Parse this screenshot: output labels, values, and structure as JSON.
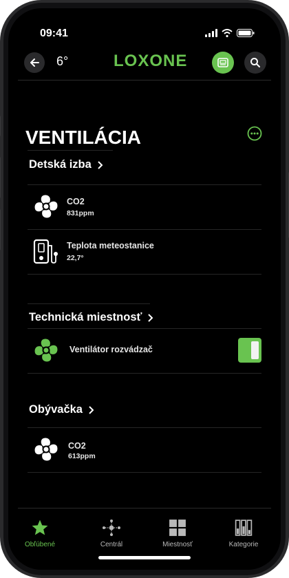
{
  "status": {
    "time": "09:41"
  },
  "header": {
    "temperature": "6°",
    "logo": "LOXONE"
  },
  "page": {
    "title": "VENTILÁCIA"
  },
  "sections": [
    {
      "title": "Detská izba",
      "rows": [
        {
          "label": "CO2",
          "value": "831ppm",
          "icon": "fan-icon"
        },
        {
          "label": "Teplota meteostanice",
          "value": "22,7°",
          "icon": "thermometer-icon"
        }
      ]
    },
    {
      "title": "Technická miestnosť",
      "rows": [
        {
          "label": "Ventilátor rozvádzač",
          "icon": "fan-icon",
          "switch_on": true
        }
      ]
    },
    {
      "title": "Obývačka",
      "rows": [
        {
          "label": "CO2",
          "value": "613ppm",
          "icon": "fan-icon"
        }
      ]
    }
  ],
  "tabs": [
    {
      "label": "Obľúbené",
      "icon": "star-icon",
      "active": true
    },
    {
      "label": "Centrál",
      "icon": "central-icon",
      "active": false
    },
    {
      "label": "Miestnosť",
      "icon": "rooms-icon",
      "active": false
    },
    {
      "label": "Kategorie",
      "icon": "categories-icon",
      "active": false
    }
  ],
  "colors": {
    "accent": "#69c350",
    "background": "#000000",
    "text": "#ffffff"
  }
}
